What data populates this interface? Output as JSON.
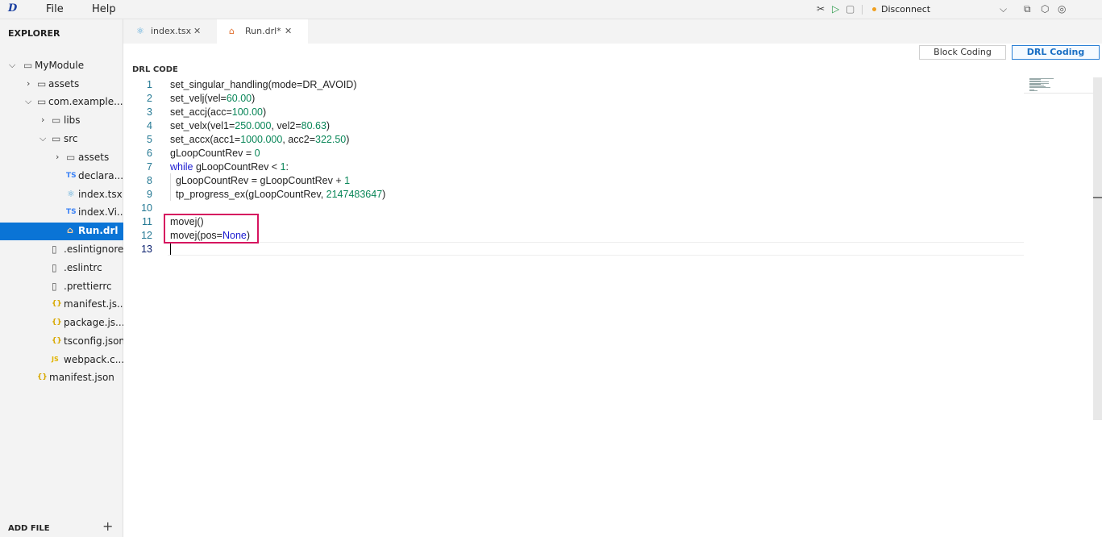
{
  "menubar": {
    "logo": "D",
    "menus": [
      "File",
      "Help"
    ],
    "status": "Disconnect",
    "colors": {
      "status_dot": "#f0a020",
      "accent": "#0a74d6"
    }
  },
  "sidebar": {
    "title": "EXPLORER",
    "items": [
      {
        "label": "MyModule",
        "chevron": "⌵",
        "icon": "folder-icon"
      },
      {
        "label": "assets",
        "chevron": "›",
        "icon": "folder-icon"
      },
      {
        "label": "com.example....",
        "chevron": "⌵",
        "icon": "folder-icon"
      },
      {
        "label": "libs",
        "chevron": "›",
        "icon": "folder-icon"
      },
      {
        "label": "src",
        "chevron": "⌵",
        "icon": "folder-icon"
      },
      {
        "label": "assets",
        "chevron": "›",
        "icon": "folder-icon"
      },
      {
        "label": "declara...",
        "badge": "TS",
        "icon": "typescript-file-icon"
      },
      {
        "label": "index.tsx",
        "badge": "⚛",
        "icon": "react-file-icon"
      },
      {
        "label": "index.Vi...",
        "badge": "TS",
        "icon": "typescript-file-icon"
      },
      {
        "label": "Run.drl",
        "badge": "⌂",
        "icon": "drl-file-icon"
      },
      {
        "label": ".eslintignore",
        "icon": "file-icon"
      },
      {
        "label": ".eslintrc",
        "icon": "file-icon"
      },
      {
        "label": ".prettierrc",
        "icon": "file-icon"
      },
      {
        "label": "manifest.js...",
        "badge": "{}",
        "icon": "json-file-icon"
      },
      {
        "label": "package.js...",
        "badge": "{}",
        "icon": "json-file-icon"
      },
      {
        "label": "tsconfig.json",
        "badge": "{}",
        "icon": "json-file-icon"
      },
      {
        "label": "webpack.c...",
        "badge": "JS",
        "icon": "javascript-file-icon"
      },
      {
        "label": "manifest.json",
        "badge": "{}",
        "icon": "json-file-icon"
      }
    ],
    "add_file": "ADD FILE",
    "add_plus": "+"
  },
  "tabs": [
    {
      "label": "index.tsx",
      "icon": "react-file-icon"
    },
    {
      "label": "Run.drl*",
      "icon": "drl-file-icon"
    }
  ],
  "mode_buttons": {
    "block": "Block Coding",
    "drl": "DRL Coding"
  },
  "editor": {
    "section_label": "DRL CODE",
    "lines": [
      {
        "n": "1",
        "parts": [
          [
            "t",
            "set_singular_handling(mode=DR_AVOID)"
          ]
        ]
      },
      {
        "n": "2",
        "parts": [
          [
            "t",
            "set_velj(vel="
          ],
          [
            "n",
            "60.00"
          ],
          [
            "t",
            ")"
          ]
        ]
      },
      {
        "n": "3",
        "parts": [
          [
            "t",
            "set_accj(acc="
          ],
          [
            "n",
            "100.00"
          ],
          [
            "t",
            ")"
          ]
        ]
      },
      {
        "n": "4",
        "parts": [
          [
            "t",
            "set_velx(vel1="
          ],
          [
            "n",
            "250.000"
          ],
          [
            "t",
            ", vel2="
          ],
          [
            "n",
            "80.63"
          ],
          [
            "t",
            ")"
          ]
        ]
      },
      {
        "n": "5",
        "parts": [
          [
            "t",
            "set_accx(acc1="
          ],
          [
            "n",
            "1000.000"
          ],
          [
            "t",
            ", acc2="
          ],
          [
            "n",
            "322.50"
          ],
          [
            "t",
            ")"
          ]
        ]
      },
      {
        "n": "6",
        "parts": [
          [
            "t",
            "gLoopCountRev = "
          ],
          [
            "n",
            "0"
          ]
        ]
      },
      {
        "n": "7",
        "parts": [
          [
            "k",
            "while"
          ],
          [
            "t",
            " gLoopCountRev < "
          ],
          [
            "n",
            "1"
          ],
          [
            "t",
            ":"
          ]
        ]
      },
      {
        "n": "8",
        "parts": [
          [
            "t",
            "  gLoopCountRev = gLoopCountRev + "
          ],
          [
            "n",
            "1"
          ]
        ]
      },
      {
        "n": "9",
        "parts": [
          [
            "t",
            "  tp_progress_ex(gLoopCountRev, "
          ],
          [
            "n",
            "2147483647"
          ],
          [
            "t",
            ")"
          ]
        ]
      },
      {
        "n": "10",
        "parts": []
      },
      {
        "n": "11",
        "parts": [
          [
            "t",
            "movej()"
          ]
        ]
      },
      {
        "n": "12",
        "parts": [
          [
            "t",
            "movej(pos="
          ],
          [
            "k",
            "None"
          ],
          [
            "t",
            ")"
          ]
        ]
      },
      {
        "n": "13",
        "parts": []
      }
    ]
  }
}
